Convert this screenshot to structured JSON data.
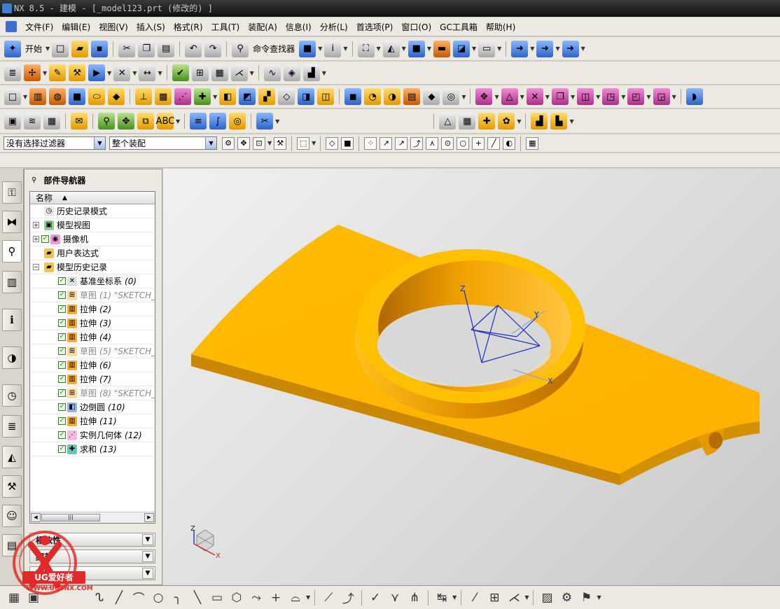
{
  "window": {
    "title": "NX 8.5 - 建模 - [_model123.prt (修改的) ]"
  },
  "menu": [
    "文件(F)",
    "编辑(E)",
    "视图(V)",
    "插入(S)",
    "格式(R)",
    "工具(T)",
    "装配(A)",
    "信息(I)",
    "分析(L)",
    "首选项(P)",
    "窗口(O)",
    "GC工具箱",
    "帮助(H)"
  ],
  "toolbar": {
    "start_label": "开始",
    "command_finder_label": "命令查找器"
  },
  "filters": {
    "selection_filter": "没有选择过滤器",
    "assembly_scope": "整个装配"
  },
  "navigator": {
    "title": "部件导航器",
    "column_header": "名称",
    "items": [
      {
        "label": "历史记录模式",
        "num": "",
        "level": 0,
        "expand": "",
        "checked": false,
        "grey": false,
        "icon": "clock-icon"
      },
      {
        "label": "模型视图",
        "num": "",
        "level": 0,
        "expand": "+",
        "checked": false,
        "grey": false,
        "icon": "model-view-icon"
      },
      {
        "label": "摄像机",
        "num": "",
        "level": 0,
        "expand": "+",
        "checked": true,
        "grey": false,
        "icon": "camera-icon"
      },
      {
        "label": "用户表达式",
        "num": "",
        "level": 0,
        "expand": "",
        "checked": false,
        "grey": false,
        "icon": "folder-icon"
      },
      {
        "label": "模型历史记录",
        "num": "",
        "level": 0,
        "expand": "-",
        "checked": false,
        "grey": false,
        "icon": "folder-icon"
      },
      {
        "label": "基准坐标系",
        "num": "(0)",
        "level": 1,
        "expand": "",
        "checked": true,
        "grey": false,
        "icon": "datum-csys-icon"
      },
      {
        "label": "草图",
        "num": "(1) \"SKETCH_",
        "level": 1,
        "expand": "",
        "checked": true,
        "grey": true,
        "icon": "sketch-icon"
      },
      {
        "label": "拉伸",
        "num": "(2)",
        "level": 1,
        "expand": "",
        "checked": true,
        "grey": false,
        "icon": "extrude-icon"
      },
      {
        "label": "拉伸",
        "num": "(3)",
        "level": 1,
        "expand": "",
        "checked": true,
        "grey": false,
        "icon": "extrude-icon"
      },
      {
        "label": "拉伸",
        "num": "(4)",
        "level": 1,
        "expand": "",
        "checked": true,
        "grey": false,
        "icon": "extrude-icon"
      },
      {
        "label": "草图",
        "num": "(5) \"SKETCH_",
        "level": 1,
        "expand": "",
        "checked": true,
        "grey": true,
        "icon": "sketch-icon"
      },
      {
        "label": "拉伸",
        "num": "(6)",
        "level": 1,
        "expand": "",
        "checked": true,
        "grey": false,
        "icon": "extrude-icon"
      },
      {
        "label": "拉伸",
        "num": "(7)",
        "level": 1,
        "expand": "",
        "checked": true,
        "grey": false,
        "icon": "extrude-icon"
      },
      {
        "label": "草图",
        "num": "(8) \"SKETCH_",
        "level": 1,
        "expand": "",
        "checked": true,
        "grey": true,
        "icon": "sketch-icon"
      },
      {
        "label": "边倒圆",
        "num": "(10)",
        "level": 1,
        "expand": "",
        "checked": true,
        "grey": false,
        "icon": "edge-blend-icon"
      },
      {
        "label": "拉伸",
        "num": "(11)",
        "level": 1,
        "expand": "",
        "checked": true,
        "grey": false,
        "icon": "extrude-icon"
      },
      {
        "label": "实例几何体",
        "num": "(12)",
        "level": 1,
        "expand": "",
        "checked": true,
        "grey": false,
        "icon": "instance-geometry-icon"
      },
      {
        "label": "求和",
        "num": "(13)",
        "level": 1,
        "expand": "",
        "checked": true,
        "grey": false,
        "icon": "unite-icon"
      }
    ],
    "sections": [
      "相依性",
      "细节",
      "预览"
    ]
  },
  "viewport": {
    "axis_labels": {
      "x": "X",
      "y": "Y",
      "z": "Z"
    },
    "model_color": "#FFB300"
  },
  "watermark": {
    "brand": "UG爱好者",
    "url": "WWW.UGSNX.COM"
  }
}
